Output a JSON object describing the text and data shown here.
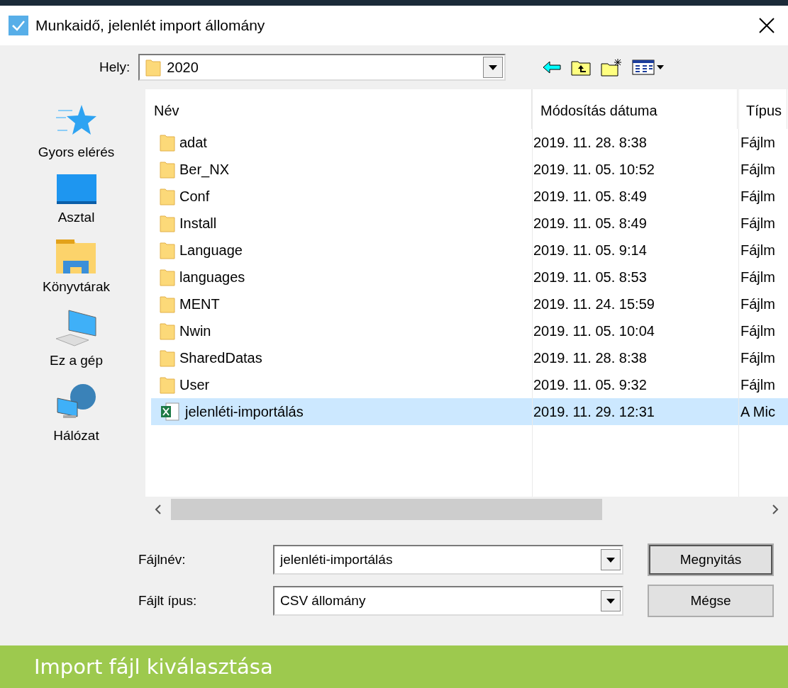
{
  "window": {
    "title": "Munkaidő, jelenlét import állomány"
  },
  "location": {
    "label": "Hely:",
    "value": "2020"
  },
  "sidebar": {
    "items": [
      {
        "kind": "star",
        "label": "Gyors elérés"
      },
      {
        "kind": "desktop",
        "label": "Asztal"
      },
      {
        "kind": "libraries",
        "label": "Könyvtárak"
      },
      {
        "kind": "computer",
        "label": "Ez a gép"
      },
      {
        "kind": "network",
        "label": "Hálózat"
      }
    ]
  },
  "table": {
    "columns": [
      "Név",
      "Módosítás dátuma",
      "Típus"
    ],
    "rows": [
      {
        "kind": "folder",
        "name": "adat",
        "date": "2019. 11. 28. 8:38",
        "type": "Fájlm",
        "selected": false
      },
      {
        "kind": "folder",
        "name": "Ber_NX",
        "date": "2019. 11. 05. 10:52",
        "type": "Fájlm",
        "selected": false
      },
      {
        "kind": "folder",
        "name": "Conf",
        "date": "2019. 11. 05. 8:49",
        "type": "Fájlm",
        "selected": false
      },
      {
        "kind": "folder",
        "name": "Install",
        "date": "2019. 11. 05. 8:49",
        "type": "Fájlm",
        "selected": false
      },
      {
        "kind": "folder",
        "name": "Language",
        "date": "2019. 11. 05. 9:14",
        "type": "Fájlm",
        "selected": false
      },
      {
        "kind": "folder",
        "name": "languages",
        "date": "2019. 11. 05. 8:53",
        "type": "Fájlm",
        "selected": false
      },
      {
        "kind": "folder",
        "name": "MENT",
        "date": "2019. 11. 24. 15:59",
        "type": "Fájlm",
        "selected": false
      },
      {
        "kind": "folder",
        "name": "Nwin",
        "date": "2019. 11. 05. 10:04",
        "type": "Fájlm",
        "selected": false
      },
      {
        "kind": "folder",
        "name": "SharedDatas",
        "date": "2019. 11. 28. 8:38",
        "type": "Fájlm",
        "selected": false
      },
      {
        "kind": "folder",
        "name": "User",
        "date": "2019. 11. 05. 9:32",
        "type": "Fájlm",
        "selected": false
      },
      {
        "kind": "excel",
        "name": "jelenléti-importálás",
        "date": "2019. 11. 29. 12:31",
        "type": "A Mic",
        "selected": true
      }
    ]
  },
  "form": {
    "filename_label": "Fájlnév:",
    "filename": "jelenléti-importálás",
    "filetype_label": "Fájlt ípus:",
    "filetype": "CSV állomány"
  },
  "buttons": [
    "Megnyitás",
    "Mégse"
  ],
  "caption": "Import fájl kiválasztása"
}
